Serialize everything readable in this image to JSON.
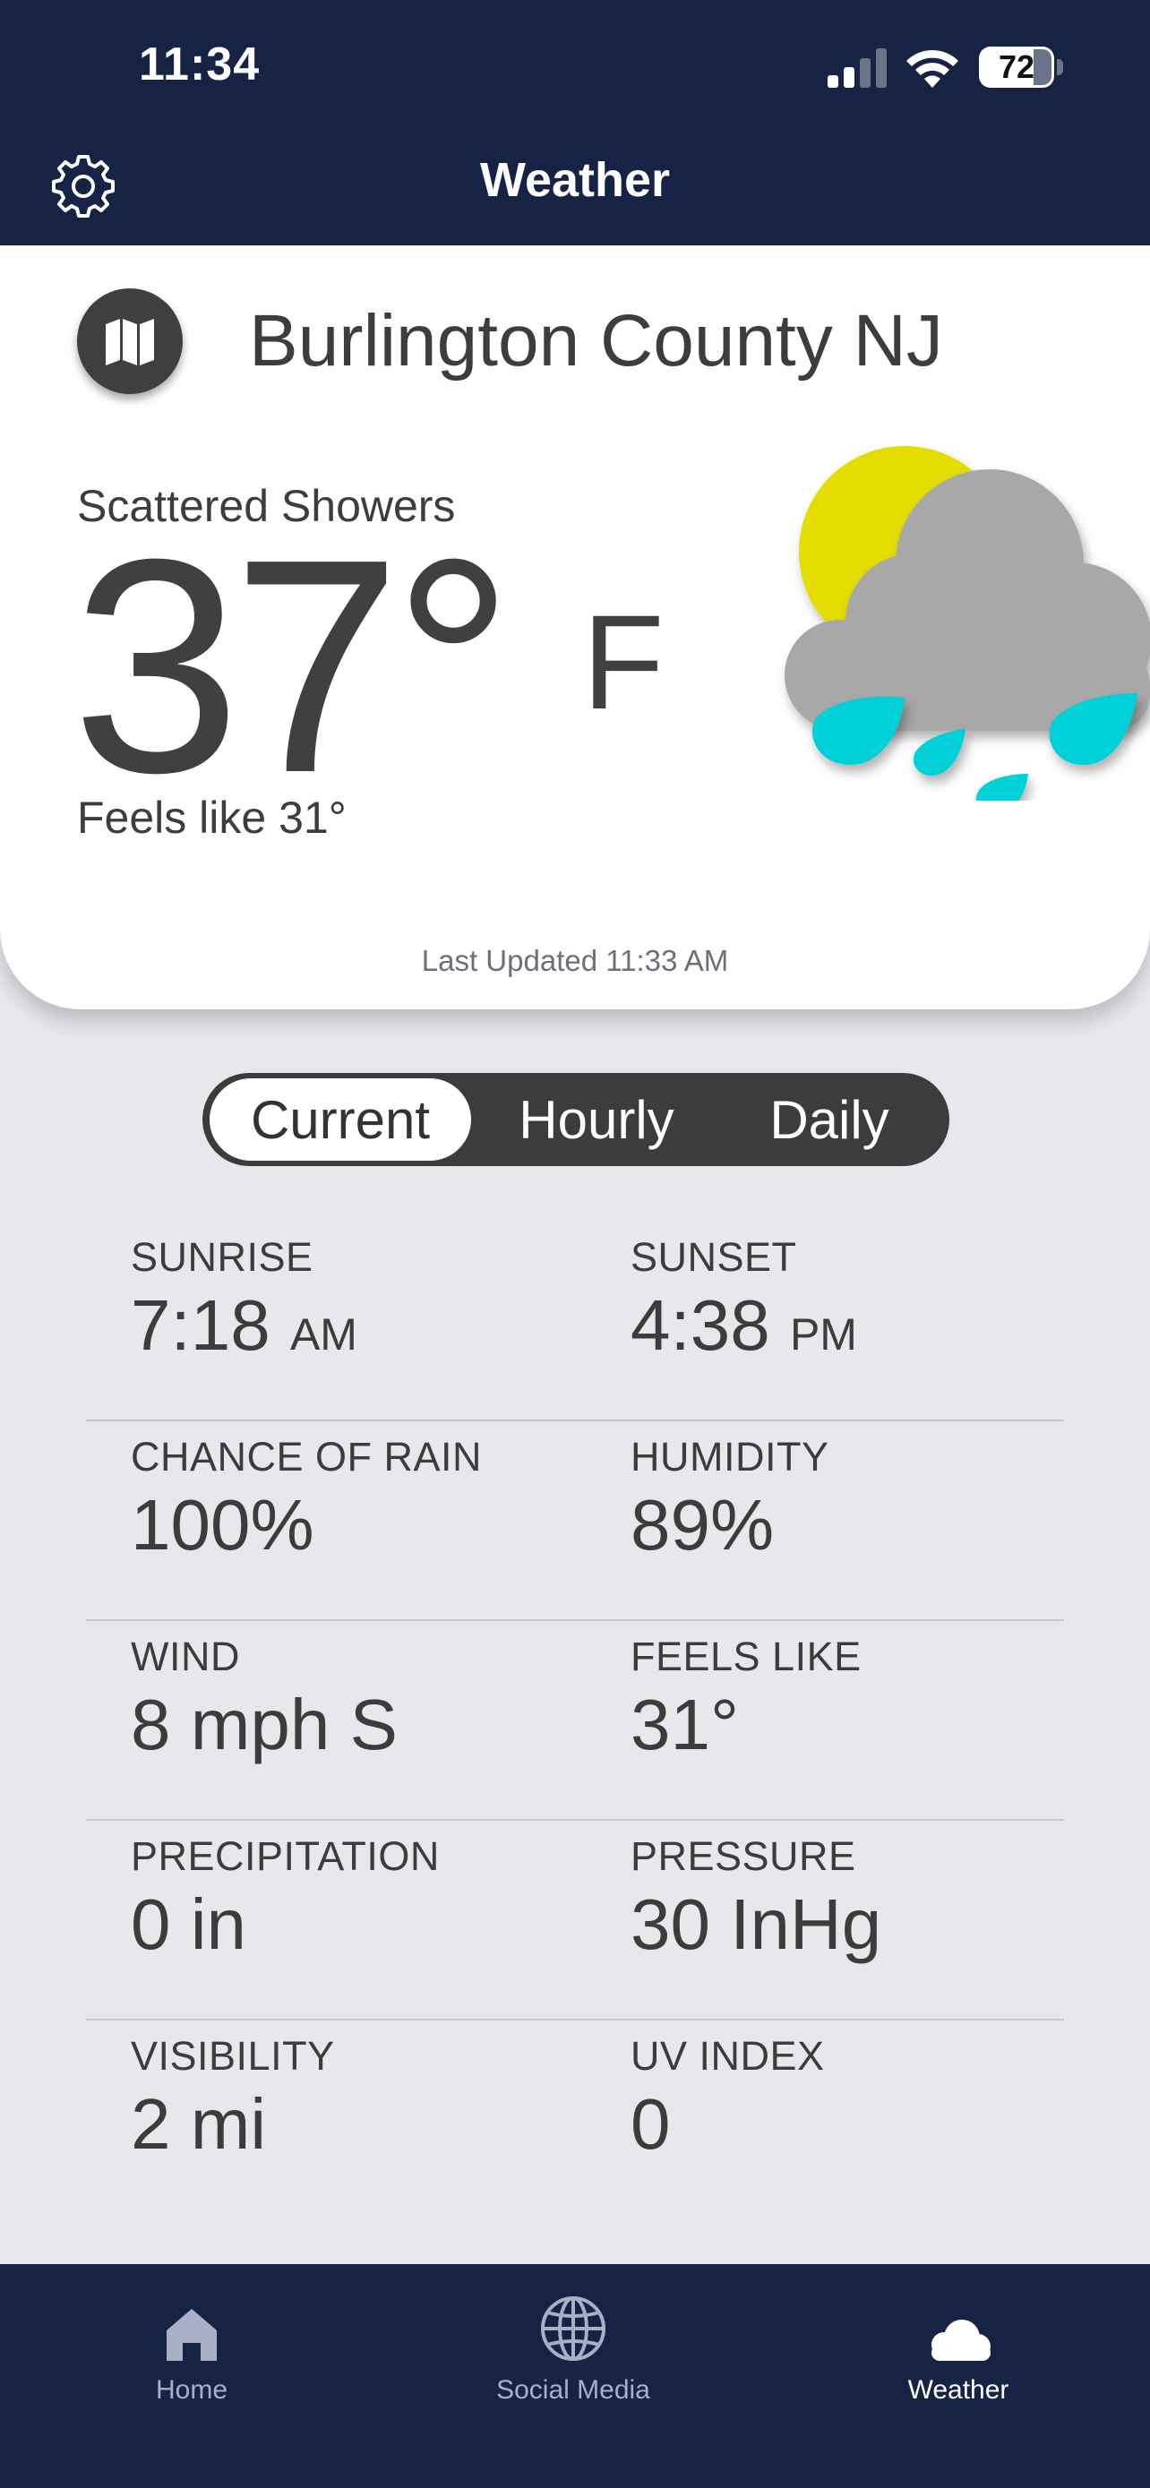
{
  "status_bar": {
    "time": "11:34",
    "battery": "72"
  },
  "header": {
    "title": "Weather"
  },
  "current": {
    "location": "Burlington County NJ",
    "condition": "Scattered Showers",
    "temperature": "37°",
    "unit": "F",
    "feels_like": "Feels like 31°",
    "last_updated": "Last Updated 11:33 AM"
  },
  "tabs": [
    "Current",
    "Hourly",
    "Daily"
  ],
  "details": {
    "sunrise_label": "SUNRISE",
    "sunrise_value": "7:18",
    "sunrise_suffix": "AM",
    "sunset_label": "SUNSET",
    "sunset_value": "4:38",
    "sunset_suffix": "PM",
    "rain_label": "CHANCE OF RAIN",
    "rain_value": "100%",
    "humidity_label": "HUMIDITY",
    "humidity_value": "89%",
    "wind_label": "WIND",
    "wind_value": "8 mph S",
    "feels_label": "FEELS LIKE",
    "feels_value": "31°",
    "precip_label": "PRECIPITATION",
    "precip_value": "0 in",
    "pressure_label": "PRESSURE",
    "pressure_value": "30 InHg",
    "visibility_label": "VISIBILITY",
    "visibility_value": "2 mi",
    "uv_label": "UV INDEX",
    "uv_value": "0"
  },
  "tabbar": {
    "home": "Home",
    "social": "Social Media",
    "weather": "Weather"
  },
  "icons": {
    "settings": "gear-icon",
    "map": "map-icon",
    "weather": "sun-cloud-rain-icon",
    "home": "home-icon",
    "social": "globe-icon",
    "weather_tab": "cloud-icon"
  },
  "colors": {
    "header_bg": "#162344",
    "sun": "#e3dd00",
    "cloud": "#a8a8a8",
    "rain": "#00d0d8",
    "tab_inactive": "#a9afc5"
  }
}
